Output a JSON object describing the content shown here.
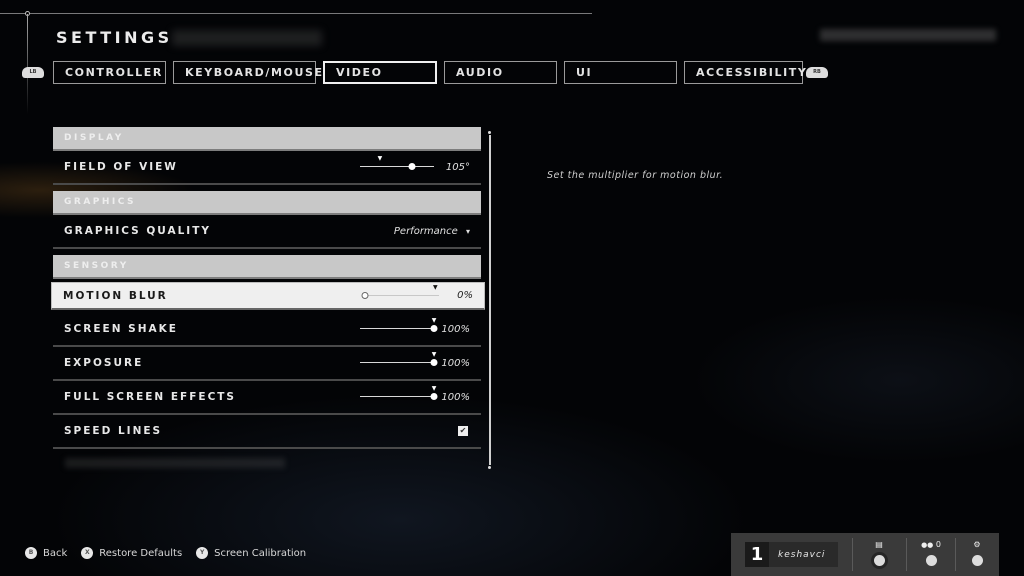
{
  "header": {
    "title": "SETTINGS"
  },
  "bumpers": {
    "left": "LB",
    "right": "RB"
  },
  "tabs": [
    {
      "label": "CONTROLLER",
      "active": false
    },
    {
      "label": "KEYBOARD/MOUSE",
      "active": false
    },
    {
      "label": "VIDEO",
      "active": true
    },
    {
      "label": "AUDIO",
      "active": false
    },
    {
      "label": "UI",
      "active": false
    },
    {
      "label": "ACCESSIBILITY",
      "active": false
    }
  ],
  "sections": {
    "display": "DISPLAY",
    "graphics": "GRAPHICS",
    "sensory": "SENSORY"
  },
  "settings": {
    "field_of_view": {
      "label": "FIELD OF VIEW",
      "value": "105°",
      "fraction": 0.7,
      "default_fraction": 0.27
    },
    "graphics_quality": {
      "label": "GRAPHICS QUALITY",
      "value": "Performance",
      "caret": "▾"
    },
    "motion_blur": {
      "label": "MOTION BLUR",
      "value": "0%",
      "fraction": 0.0,
      "default_fraction": 0.95
    },
    "screen_shake": {
      "label": "SCREEN SHAKE",
      "value": "100%",
      "fraction": 1.0,
      "default_fraction": 1.0
    },
    "exposure": {
      "label": "EXPOSURE",
      "value": "100%",
      "fraction": 1.0,
      "default_fraction": 1.0
    },
    "full_screen_effects": {
      "label": "FULL SCREEN EFFECTS",
      "value": "100%",
      "fraction": 1.0,
      "default_fraction": 1.0
    },
    "speed_lines": {
      "label": "SPEED LINES",
      "checked": true,
      "check": "✔"
    }
  },
  "help_text": "Set the multiplier for motion blur.",
  "footer": {
    "back": {
      "glyph": "B",
      "label": "Back"
    },
    "restore": {
      "glyph": "X",
      "label": "Restore Defaults"
    },
    "calibration": {
      "glyph": "Y",
      "label": "Screen Calibration"
    }
  },
  "dock": {
    "player_number": "1",
    "player_name": "keshavci",
    "chat_icon": "▤",
    "friends_count": "0",
    "friends_icon": "👥",
    "settings_icon": "⚙"
  }
}
